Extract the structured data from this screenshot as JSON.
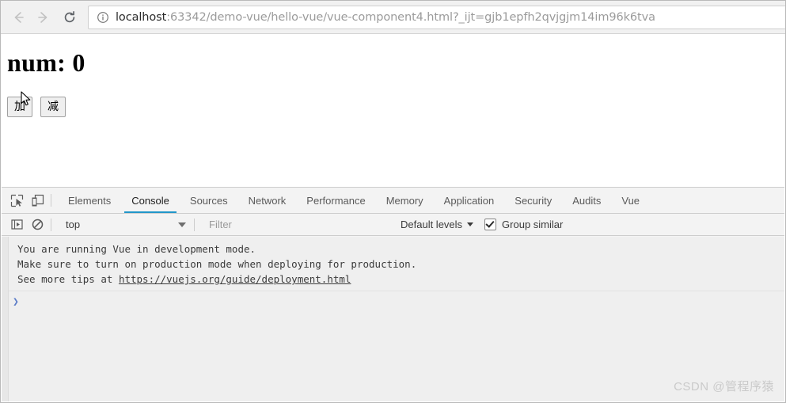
{
  "browser": {
    "back_label": "Back",
    "forward_label": "Forward",
    "reload_label": "Reload",
    "site_info_label": "View site information",
    "url_host": "localhost",
    "url_rest": ":63342/demo-vue/hello-vue/vue-component4.html?_ijt=gjb1epfh2qvjgjm14im96k6tva",
    "url_full": "localhost:63342/demo-vue/hello-vue/vue-component4.html?_ijt=gjb1epfh2qvjgjm14im96k6tva"
  },
  "page": {
    "heading": "num: 0",
    "buttons": [
      {
        "label": "加",
        "name": "increment-button"
      },
      {
        "label": "减",
        "name": "decrement-button"
      }
    ]
  },
  "devtools": {
    "inspect_icon_label": "inspect-element",
    "device_icon_label": "toggle-device-toolbar",
    "tabs": [
      {
        "label": "Elements",
        "active": false
      },
      {
        "label": "Console",
        "active": true
      },
      {
        "label": "Sources",
        "active": false
      },
      {
        "label": "Network",
        "active": false
      },
      {
        "label": "Performance",
        "active": false
      },
      {
        "label": "Memory",
        "active": false
      },
      {
        "label": "Application",
        "active": false
      },
      {
        "label": "Security",
        "active": false
      },
      {
        "label": "Audits",
        "active": false
      },
      {
        "label": "Vue",
        "active": false
      }
    ],
    "console_toolbar": {
      "sidebar_toggle_label": "show-console-sidebar",
      "clear_label": "clear-console",
      "context": "top",
      "filter_placeholder": "Filter",
      "levels": "Default levels",
      "group_similar": "Group similar",
      "group_similar_checked": true
    },
    "console_messages": [
      "You are running Vue in development mode.",
      "Make sure to turn on production mode when deploying for production.",
      "See more tips at "
    ],
    "console_link": "https://vuejs.org/guide/deployment.html",
    "prompt_symbol": "❯"
  },
  "watermark": "CSDN @管程序猿",
  "colors": {
    "accent": "#2196c9",
    "toolbar_bg": "#f1f1f1",
    "devtools_bg": "#f3f3f3",
    "console_bg": "#efefef",
    "prompt_blue": "#5b7cc8"
  }
}
